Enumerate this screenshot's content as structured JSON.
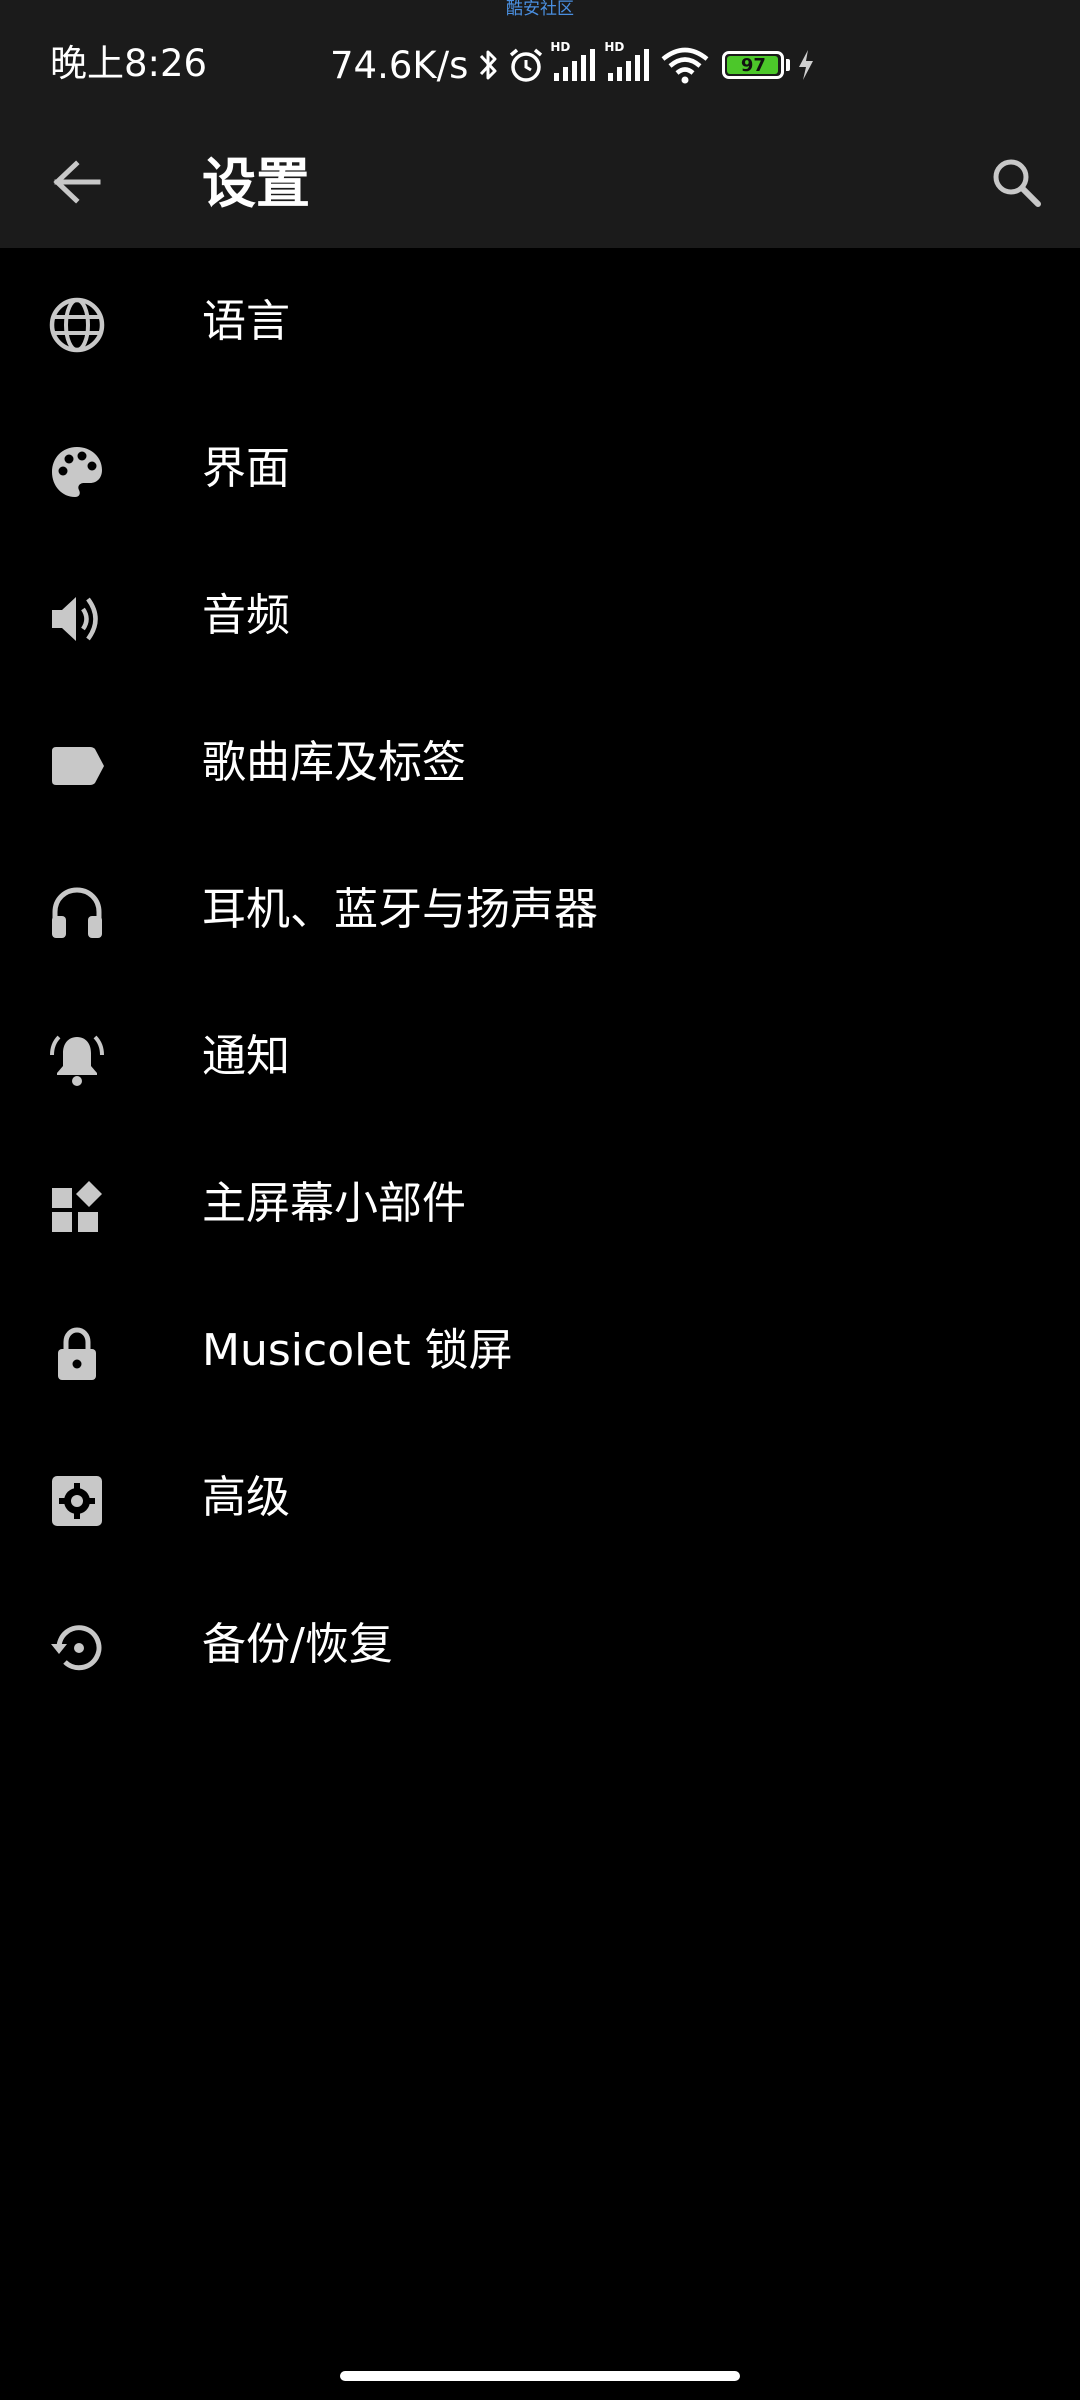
{
  "status_bar": {
    "watermark": "酷安社区",
    "time": "晚上8:26",
    "net_speed": "74.6K/s",
    "sim1_label": "HD",
    "sim2_label": "HD",
    "battery_level": "97",
    "battery_fill_percent": 97,
    "battery_color": "#4cc72a",
    "icons": [
      "bluetooth-icon",
      "alarm-icon",
      "signal-icon",
      "signal-icon",
      "wifi-icon",
      "battery-icon",
      "charging-icon"
    ]
  },
  "appbar": {
    "title": "设置",
    "back_icon": "arrow-left-icon",
    "search_icon": "search-icon"
  },
  "settings": [
    {
      "label": "语言",
      "icon": "globe-icon"
    },
    {
      "label": "界面",
      "icon": "palette-icon"
    },
    {
      "label": "音频",
      "icon": "speaker-icon"
    },
    {
      "label": "歌曲库及标签",
      "icon": "label-icon"
    },
    {
      "label": "耳机、蓝牙与扬声器",
      "icon": "headphones-icon"
    },
    {
      "label": "通知",
      "icon": "bell-icon"
    },
    {
      "label": "主屏幕小部件",
      "icon": "widgets-icon"
    },
    {
      "label": "Musicolet 锁屏",
      "icon": "lock-icon"
    },
    {
      "label": "高级",
      "icon": "gear-icon"
    },
    {
      "label": "备份/恢复",
      "icon": "restore-icon"
    }
  ],
  "colors": {
    "bar_background": "#1b1b1b",
    "page_background": "#000000",
    "icon_color": "#c8c8c8",
    "text_color": "#ffffff"
  }
}
